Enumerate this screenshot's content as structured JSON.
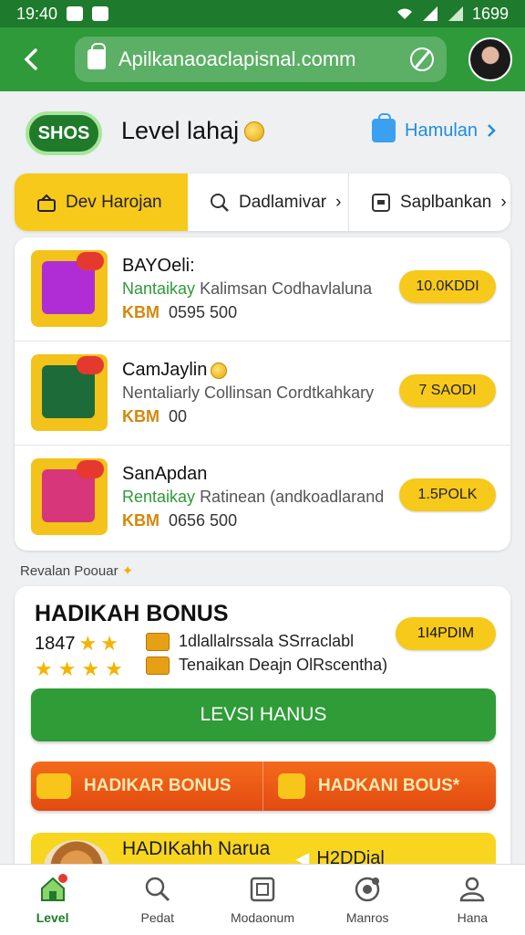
{
  "status_bar": {
    "time": "19:40",
    "battery": "1699"
  },
  "browser": {
    "url": "Apilkanaoaclapisnal.comm"
  },
  "header": {
    "level_badge": "SHOS",
    "title": "Level lahaj",
    "help_link": "Hamulan"
  },
  "tabs": [
    {
      "label": "Dev Harojan",
      "icon": "gift-icon",
      "active": true
    },
    {
      "label": "Dadlamivar",
      "icon": "search-icon",
      "active": false
    },
    {
      "label": "Saplbankan",
      "icon": "card-icon",
      "active": false
    }
  ],
  "products": [
    {
      "name": "BAYOeli:",
      "desc_green": "Nantaikay",
      "desc_rest": "Kalimsan Codhavlaluna",
      "price_code": "KBM",
      "price": "0595 500",
      "button": "10.0KDDI",
      "color": "#b02dd6"
    },
    {
      "name": "CamJaylin",
      "desc_green": "",
      "desc_rest": "Nentaliarly Collinsan Cordtkahkary",
      "price_code": "KBM",
      "price": "00",
      "button": "7 SAODI",
      "color": "#1e6b3a"
    },
    {
      "name": "SanApdan",
      "desc_green": "Rentaikay",
      "desc_rest": "Ratinean (andkoadlarand",
      "price_code": "KBM",
      "price": "0656 500",
      "button": "1.5POLK",
      "color": "#d8367a"
    }
  ],
  "section_label": "Revalan Poouar",
  "bonus": {
    "title": "HADIKAH BONUS",
    "count": "1847",
    "info_1": "1dlallalrssala SSrraclabl",
    "info_2": "Tenaikan Deajn OlRscentha)",
    "pill": "1I4PDIM",
    "green_button": "LEVSI HANUS",
    "orange_left": "HADIKAR BONUS",
    "orange_right": "HADKANI BOUS*",
    "yellow_title": "HADIKahh Narua",
    "yellow_value": "H2DDjal"
  },
  "bottom_nav": [
    {
      "label": "Level",
      "icon": "home-icon",
      "active": true
    },
    {
      "label": "Pedat",
      "icon": "search-icon",
      "active": false
    },
    {
      "label": "Modaonum",
      "icon": "document-icon",
      "active": false
    },
    {
      "label": "Manros",
      "icon": "target-icon",
      "active": false
    },
    {
      "label": "Hana",
      "icon": "people-icon",
      "active": false
    }
  ],
  "colors": {
    "primary_green": "#2e9a3a",
    "accent_yellow": "#f6c91b",
    "orange": "#f46a1c",
    "link_blue": "#1f8de0"
  }
}
